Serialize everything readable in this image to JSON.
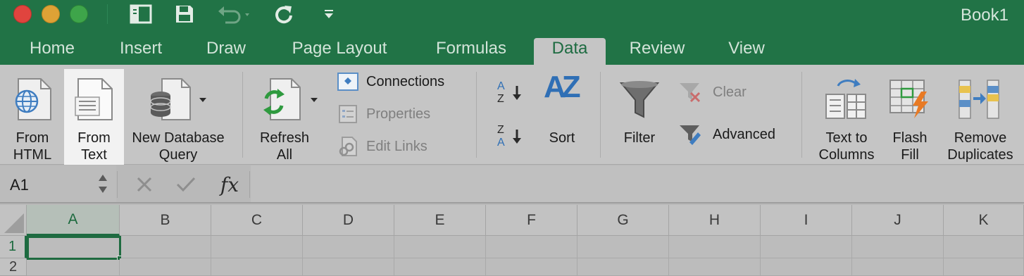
{
  "window": {
    "title": "Book1"
  },
  "quick_access": {
    "icons": [
      "sidebar-icon",
      "save-icon",
      "undo-icon",
      "redo-icon",
      "customize-toolbar-icon"
    ]
  },
  "tabs": [
    {
      "label": "Home"
    },
    {
      "label": "Insert"
    },
    {
      "label": "Draw"
    },
    {
      "label": "Page Layout"
    },
    {
      "label": "Formulas"
    },
    {
      "label": "Data",
      "active": true
    },
    {
      "label": "Review"
    },
    {
      "label": "View"
    }
  ],
  "ribbon": {
    "from_html": {
      "line1": "From",
      "line2": "HTML"
    },
    "from_text": {
      "line1": "From",
      "line2": "Text"
    },
    "new_db_query": {
      "line1": "New Database",
      "line2": "Query"
    },
    "refresh_all": {
      "line1": "Refresh",
      "line2": "All"
    },
    "connections": "Connections",
    "properties": "Properties",
    "edit_links": "Edit Links",
    "sort_az": "A Z",
    "sort_za": "Z A",
    "sort": "Sort",
    "sort_glyph": "AZ",
    "filter": "Filter",
    "clear": "Clear",
    "advanced": "Advanced",
    "text_to_columns": {
      "line1": "Text to",
      "line2": "Columns"
    },
    "flash_fill": {
      "line1": "Flash",
      "line2": "Fill"
    },
    "remove_duplicates": {
      "line1": "Remove",
      "line2": "Duplicates"
    }
  },
  "formula_bar": {
    "name_box": "A1",
    "fx": "fx",
    "formula": ""
  },
  "grid": {
    "columns": [
      "A",
      "B",
      "C",
      "D",
      "E",
      "F",
      "G",
      "H",
      "I",
      "J",
      "K"
    ],
    "rows": [
      "1",
      "2"
    ],
    "selected_cell": "A1"
  },
  "colors": {
    "accent": "#217346",
    "active_tab_text": "#1d6b41",
    "ribbon_bg": "#c5c5c5"
  }
}
